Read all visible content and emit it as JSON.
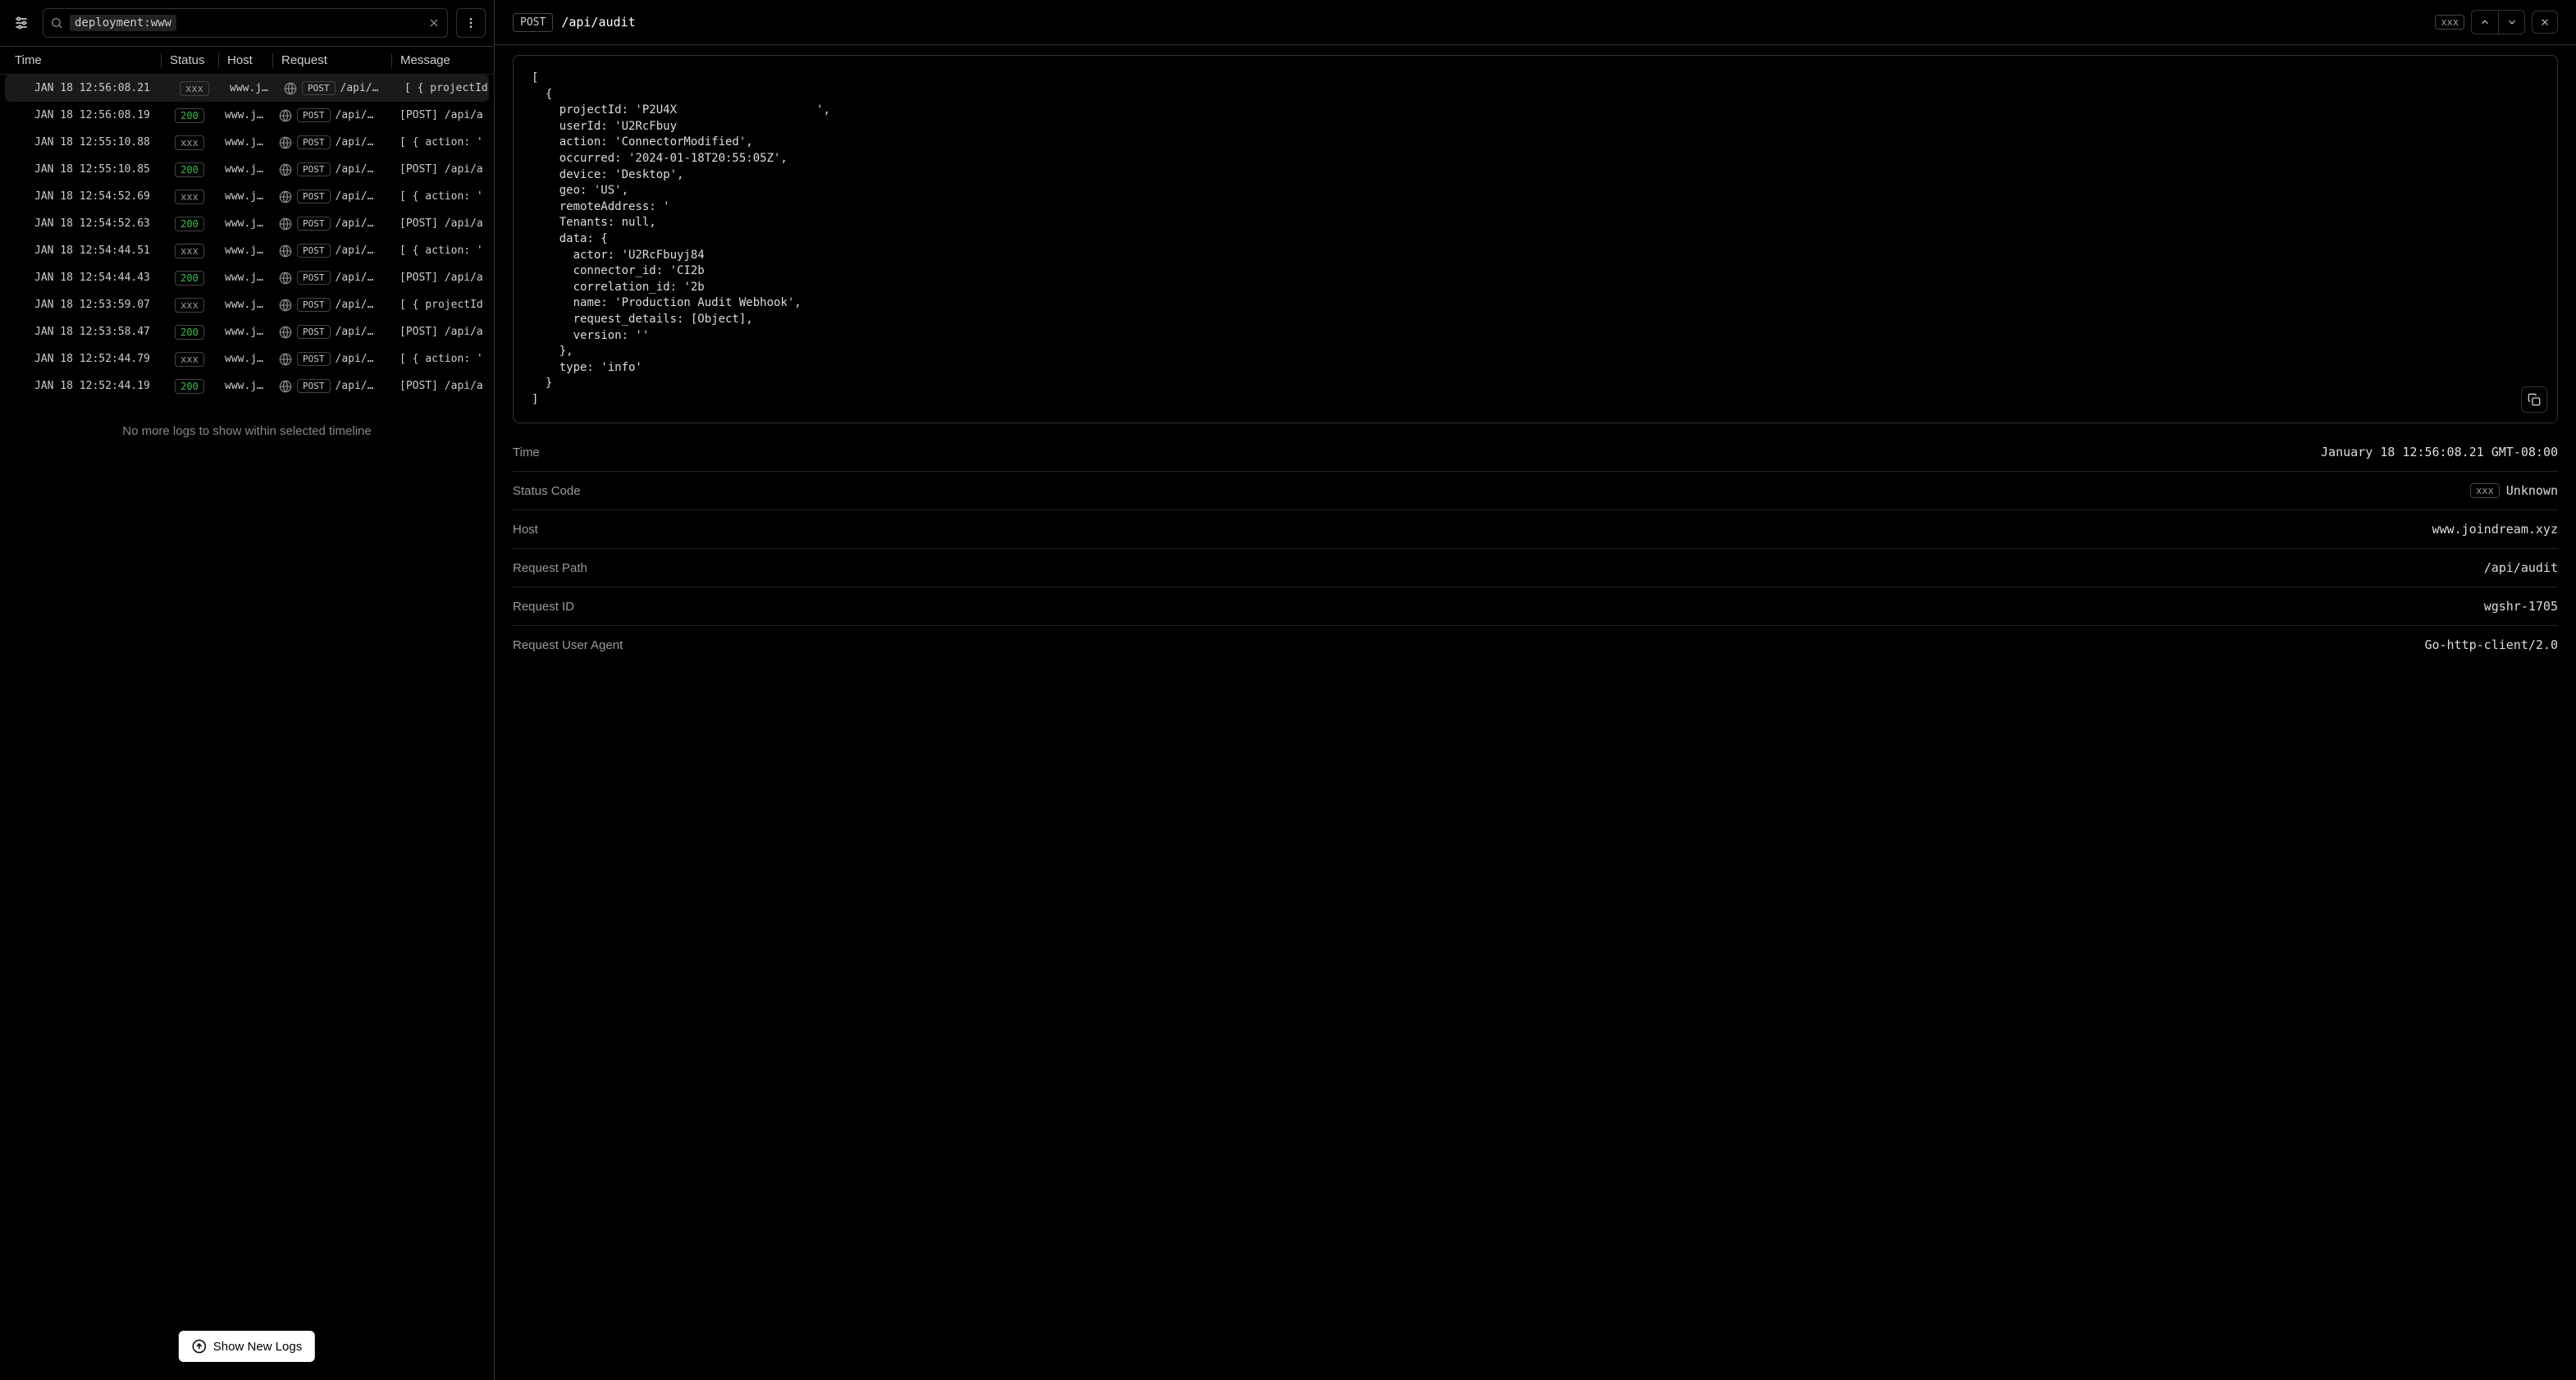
{
  "search": {
    "chip": "deployment:www"
  },
  "columns": {
    "time": "Time",
    "status": "Status",
    "host": "Host",
    "request": "Request",
    "message": "Message"
  },
  "logs": [
    {
      "time": "JAN 18 12:56:08.21",
      "status": "xxx",
      "ok": false,
      "host": "www.j…",
      "method": "POST",
      "path": "/api/…",
      "message": "[ { projectId",
      "selected": true
    },
    {
      "time": "JAN 18 12:56:08.19",
      "status": "200",
      "ok": true,
      "host": "www.j…",
      "method": "POST",
      "path": "/api/…",
      "message": "[POST] /api/a"
    },
    {
      "time": "JAN 18 12:55:10.88",
      "status": "xxx",
      "ok": false,
      "host": "www.j…",
      "method": "POST",
      "path": "/api/…",
      "message": "[ { action: '"
    },
    {
      "time": "JAN 18 12:55:10.85",
      "status": "200",
      "ok": true,
      "host": "www.j…",
      "method": "POST",
      "path": "/api/…",
      "message": "[POST] /api/a"
    },
    {
      "time": "JAN 18 12:54:52.69",
      "status": "xxx",
      "ok": false,
      "host": "www.j…",
      "method": "POST",
      "path": "/api/…",
      "message": "[ { action: '"
    },
    {
      "time": "JAN 18 12:54:52.63",
      "status": "200",
      "ok": true,
      "host": "www.j…",
      "method": "POST",
      "path": "/api/…",
      "message": "[POST] /api/a"
    },
    {
      "time": "JAN 18 12:54:44.51",
      "status": "xxx",
      "ok": false,
      "host": "www.j…",
      "method": "POST",
      "path": "/api/…",
      "message": "[ { action: '"
    },
    {
      "time": "JAN 18 12:54:44.43",
      "status": "200",
      "ok": true,
      "host": "www.j…",
      "method": "POST",
      "path": "/api/…",
      "message": "[POST] /api/a"
    },
    {
      "time": "JAN 18 12:53:59.07",
      "status": "xxx",
      "ok": false,
      "host": "www.j…",
      "method": "POST",
      "path": "/api/…",
      "message": "[ { projectId"
    },
    {
      "time": "JAN 18 12:53:58.47",
      "status": "200",
      "ok": true,
      "host": "www.j…",
      "method": "POST",
      "path": "/api/…",
      "message": "[POST] /api/a"
    },
    {
      "time": "JAN 18 12:52:44.79",
      "status": "xxx",
      "ok": false,
      "host": "www.j…",
      "method": "POST",
      "path": "/api/…",
      "message": "[ { action: '"
    },
    {
      "time": "JAN 18 12:52:44.19",
      "status": "200",
      "ok": true,
      "host": "www.j…",
      "method": "POST",
      "path": "/api/…",
      "message": "[POST] /api/a"
    }
  ],
  "noMoreLogs": "No more logs to show within selected timeline",
  "showNewLogs": "Show New Logs",
  "detail": {
    "method": "POST",
    "path": "/api/audit",
    "statusBadge": "xxx",
    "code": {
      "l0": "[",
      "l1": "  {",
      "l2a": "    projectId: 'P2U4X",
      "l2b": "',",
      "l3": "    userId: 'U2RcFbuy",
      "l4": "    action: 'ConnectorModified',",
      "l5": "    occurred: '2024-01-18T20:55:05Z',",
      "l6": "    device: 'Desktop',",
      "l7": "    geo: 'US',",
      "l8": "    remoteAddress: '",
      "l9": "    Tenants: null,",
      "l10": "    data: {",
      "l11": "      actor: 'U2RcFbuyj84",
      "l12": "      connector_id: 'CI2b",
      "l13": "      correlation_id: '2b",
      "l14": "      name: 'Production Audit Webhook',",
      "l15": "      request_details: [Object],",
      "l16": "      version: ''",
      "l17": "    },",
      "l18": "    type: 'info'",
      "l19": "  }",
      "l20": "]"
    },
    "meta": {
      "timeLabel": "Time",
      "timeValue": "January 18 12:56:08.21 GMT-08:00",
      "statusLabel": "Status Code",
      "statusValue": "Unknown",
      "hostLabel": "Host",
      "hostValue": "www.joindream.xyz",
      "requestPathLabel": "Request Path",
      "requestPathValue": "/api/audit",
      "requestIdLabel": "Request ID",
      "requestIdValue": "wgshr-1705",
      "userAgentLabel": "Request User Agent",
      "userAgentValue": "Go-http-client/2.0"
    }
  }
}
